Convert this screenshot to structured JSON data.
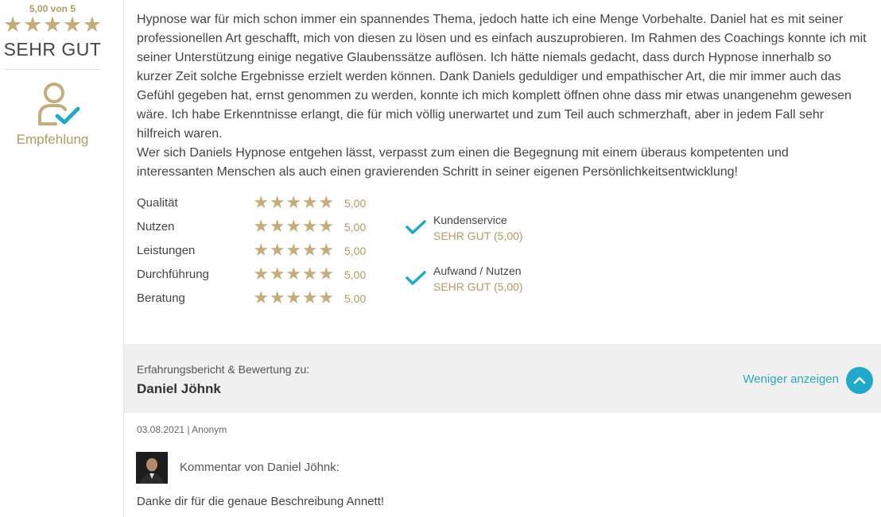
{
  "sidebar": {
    "score_label": "5,00 von 5",
    "stars": 5,
    "rating_text": "SEHR GUT",
    "recommendation_label": "Empfehlung",
    "recommendation_icon": "person-check-icon"
  },
  "review": {
    "paragraphs": [
      "Hypnose war für mich schon immer ein spannendes Thema, jedoch hatte ich eine Menge Vorbehalte. Daniel hat es mit seiner professionellen Art geschafft, mich von diesen zu lösen und es einfach auszuprobieren. Im Rahmen des Coachings konnte ich mit seiner Unterstützung einige negative Glaubenssätze auflösen. Ich hätte niemals gedacht, dass durch Hypnose innerhalb so kurzer Zeit solche Ergebnisse erzielt werden können. Dank Daniels geduldiger und empathischer Art, die mir immer auch das Gefühl gegeben hat, ernst genommen zu werden, konnte ich mich komplett öffnen ohne dass mir etwas unangenehm gewesen wäre. Ich habe Erkenntnisse erlangt, die für mich völlig unerwartet und zum Teil auch schmerzhaft, aber in jedem Fall sehr hilfreich waren.",
      "Wer sich Daniels Hypnose entgehen lässt, verpasst zum einen die Begegnung mit einem überaus kompetenten und interessanten Menschen als auch einen gravierenden Schritt in seiner eigenen Persönlichkeitsentwicklung!"
    ]
  },
  "ratings": [
    {
      "name": "Qualität",
      "stars": 5,
      "value": "5,00"
    },
    {
      "name": "Nutzen",
      "stars": 5,
      "value": "5,00"
    },
    {
      "name": "Leistungen",
      "stars": 5,
      "value": "5,00"
    },
    {
      "name": "Durchführung",
      "stars": 5,
      "value": "5,00"
    },
    {
      "name": "Beratung",
      "stars": 5,
      "value": "5,00"
    }
  ],
  "checks": [
    {
      "title": "Kundenservice",
      "value": "SEHR GUT (5,00)"
    },
    {
      "title": "Aufwand / Nutzen",
      "value": "SEHR GUT (5,00)"
    }
  ],
  "footer": {
    "title": "Erfahrungsbericht & Bewertung zu:",
    "name": "Daniel Jöhnk",
    "less_label": "Weniger anzeigen"
  },
  "meta": "03.08.2021 | Anonym",
  "comment": {
    "label": "Kommentar von Daniel Jöhnk:",
    "text": "Danke dir für die genaue Beschreibung Annett!"
  },
  "colors": {
    "gold": "#c5ad7b",
    "gold_text": "#b49a62",
    "accent": "#21a9c9",
    "band": "#f0f0f0"
  }
}
